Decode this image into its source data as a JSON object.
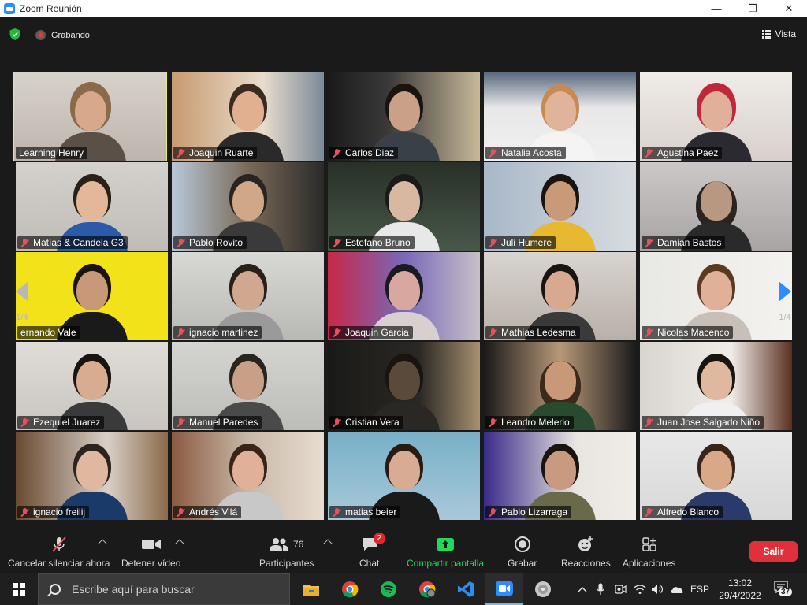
{
  "window": {
    "title": "Zoom Reunión",
    "minimize": "—",
    "maximize": "❐",
    "close": "✕"
  },
  "meeting": {
    "recording_label": "Grabando",
    "view_label": "Vista",
    "page_indicator_left": "1/4",
    "page_indicator_right": "1/4"
  },
  "participants": [
    "Learning Henry",
    "Joaquin Ruarte",
    "Carlos Diaz",
    "Natalia Acosta",
    "Agustina Paez",
    "Matías & Candela G3",
    "Pablo Rovito",
    "Estefano Bruno",
    "Juli Humere",
    "Damian Bastos",
    "ernando Vale",
    "ignacio martinez",
    "Joaquin Garcia",
    "Mathias Ledesma",
    "Nicolas Macenco",
    "Ezequiel Juarez",
    "Manuel Paredes",
    "Cristian Vera",
    "Leandro Melerio",
    "Juan Jose Salgado Niño",
    "ignacio freilij",
    "Andrés Vilá",
    "matias beier",
    "Pablo Lizarraga",
    "Alfredo Blanco"
  ],
  "toolbar": {
    "mute_label": "Cancelar silenciar ahora",
    "video_label": "Detener vídeo",
    "participants_label": "Participantes",
    "participants_count": "76",
    "chat_label": "Chat",
    "chat_badge": "2",
    "share_label": "Compartir pantalla",
    "record_label": "Grabar",
    "reactions_label": "Reacciones",
    "apps_label": "Aplicaciones",
    "leave_label": "Salir"
  },
  "taskbar": {
    "search_placeholder": "Escribe aquí para buscar",
    "language": "ESP",
    "time": "13:02",
    "date": "29/4/2022",
    "notification_count": "37"
  },
  "colors": {
    "accent_blue": "#2d8cff",
    "active_speaker_border": "#e5ef6a",
    "leave_red": "#e0303b",
    "share_green": "#23d959",
    "muted_red": "#e9505d"
  }
}
